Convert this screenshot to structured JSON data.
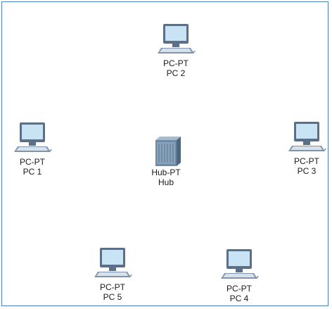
{
  "colors": {
    "border": "#4f81bd",
    "monitor_frame": "#5b6f86",
    "screen": "#c8e3f3",
    "base": "#7f95ab",
    "keyboard": "#d8e1ea",
    "hub_body": "#6f8aa4",
    "label": "#1a1a1a"
  },
  "devices": [
    {
      "id": "pc2",
      "type": "pc-icon",
      "model": "PC-PT",
      "name": "PC 2"
    },
    {
      "id": "pc1",
      "type": "pc-icon",
      "model": "PC-PT",
      "name": "PC 1"
    },
    {
      "id": "hub",
      "type": "hub-icon",
      "model": "Hub-PT",
      "name": "Hub"
    },
    {
      "id": "pc3",
      "type": "pc-icon",
      "model": "PC-PT",
      "name": "PC 3"
    },
    {
      "id": "pc5",
      "type": "pc-icon",
      "model": "PC-PT",
      "name": "PC 5"
    },
    {
      "id": "pc4",
      "type": "pc-icon",
      "model": "PC-PT",
      "name": "PC 4"
    }
  ]
}
